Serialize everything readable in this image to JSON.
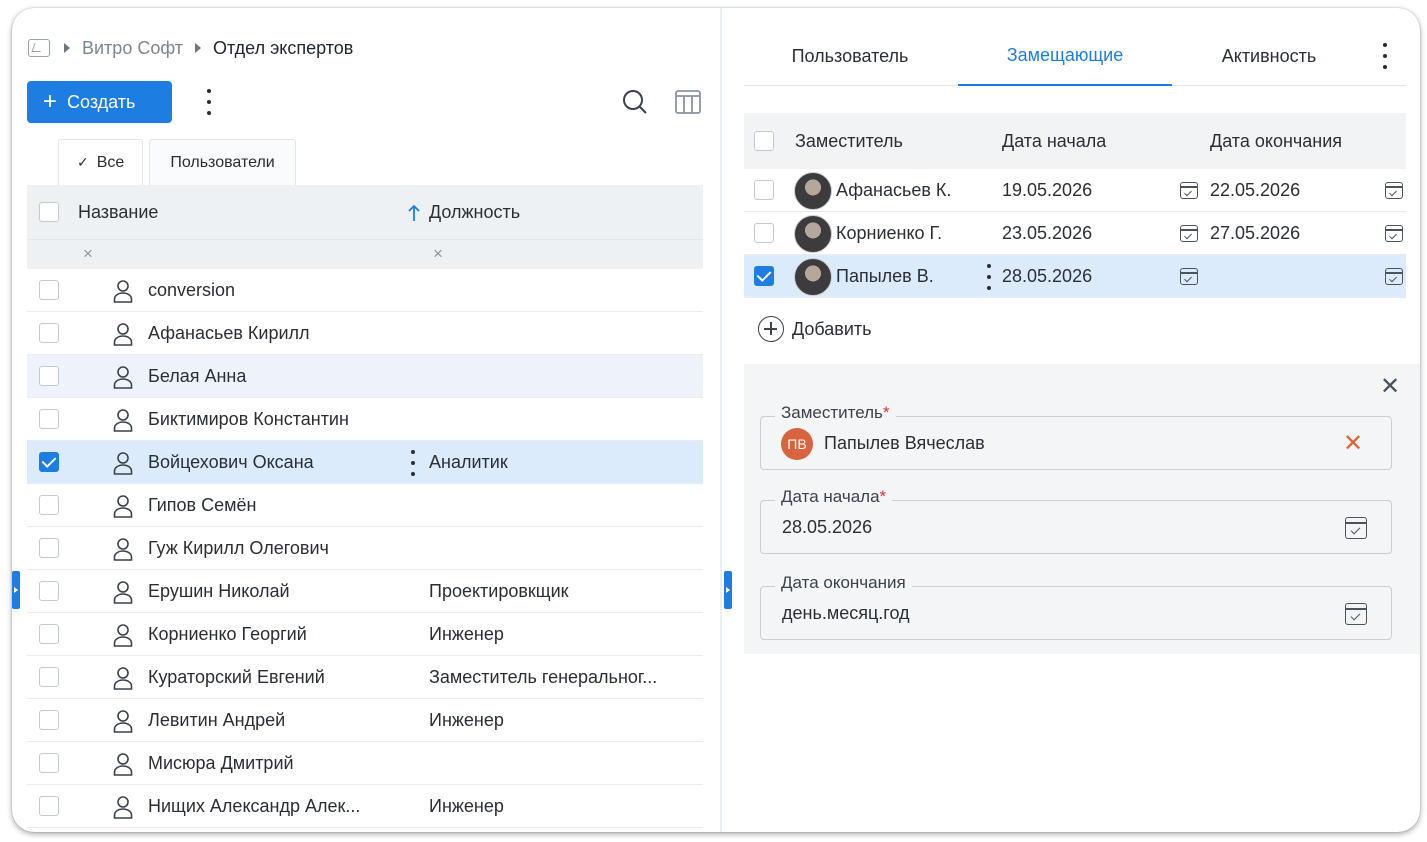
{
  "breadcrumb": {
    "org": "Витро Софт",
    "current": "Отдел экспертов"
  },
  "toolbar": {
    "create_label": "Создать"
  },
  "left_tabs": [
    {
      "label": "Все",
      "active": true
    },
    {
      "label": "Пользователи",
      "active": false
    }
  ],
  "table": {
    "columns": {
      "name": "Название",
      "position": "Должность"
    },
    "sort": "ascending",
    "rows": [
      {
        "name": "conversion",
        "position": "",
        "checked": false,
        "state": ""
      },
      {
        "name": "Афанасьев Кирилл",
        "position": "",
        "checked": false,
        "state": ""
      },
      {
        "name": "Белая Анна",
        "position": "",
        "checked": false,
        "state": "hover"
      },
      {
        "name": "Биктимиров Константин",
        "position": "",
        "checked": false,
        "state": ""
      },
      {
        "name": "Войцехович Оксана",
        "position": "Аналитик",
        "checked": true,
        "state": "selected"
      },
      {
        "name": "Гипов Семён",
        "position": "",
        "checked": false,
        "state": ""
      },
      {
        "name": "Гуж Кирилл Олегович",
        "position": "",
        "checked": false,
        "state": ""
      },
      {
        "name": "Ерушин Николай",
        "position": "Проектировкщик",
        "checked": false,
        "state": ""
      },
      {
        "name": "Корниенко Георгий",
        "position": "Инженер",
        "checked": false,
        "state": ""
      },
      {
        "name": "Кураторский Евгений",
        "position": "Заместитель генеральног...",
        "checked": false,
        "state": ""
      },
      {
        "name": "Левитин Андрей",
        "position": "Инженер",
        "checked": false,
        "state": ""
      },
      {
        "name": "Мисюра Дмитрий",
        "position": "",
        "checked": false,
        "state": ""
      },
      {
        "name": "Нищих Александр Алек...",
        "position": "Инженер",
        "checked": false,
        "state": ""
      }
    ]
  },
  "right_tabs": [
    {
      "label": "Пользователь",
      "active": false
    },
    {
      "label": "Замещающие",
      "active": true
    },
    {
      "label": "Активность",
      "active": false
    }
  ],
  "deputies": {
    "columns": {
      "deputy": "Заместитель",
      "start": "Дата начала",
      "end": "Дата окончания"
    },
    "rows": [
      {
        "name": "Афанасьев К.",
        "start": "19.05.2026",
        "end": "22.05.2026",
        "checked": false
      },
      {
        "name": "Корниенко Г.",
        "start": "23.05.2026",
        "end": "27.05.2026",
        "checked": false
      },
      {
        "name": "Папылев В.",
        "start": "28.05.2026",
        "end": "",
        "checked": true
      }
    ],
    "add_label": "Добавить"
  },
  "form": {
    "deputy_label": "Заместитель",
    "deputy_initials": "ПВ",
    "deputy_value": "Папылев Вячеслав",
    "start_label": "Дата начала",
    "start_value": "28.05.2026",
    "end_label": "Дата окончания",
    "end_placeholder": "день.месяц.год",
    "required_mark": "*"
  },
  "colors": {
    "accent": "#1e7de0",
    "selected_row": "#dcebfb",
    "required": "#d9342b",
    "avatar_badge": "#d8643f"
  }
}
